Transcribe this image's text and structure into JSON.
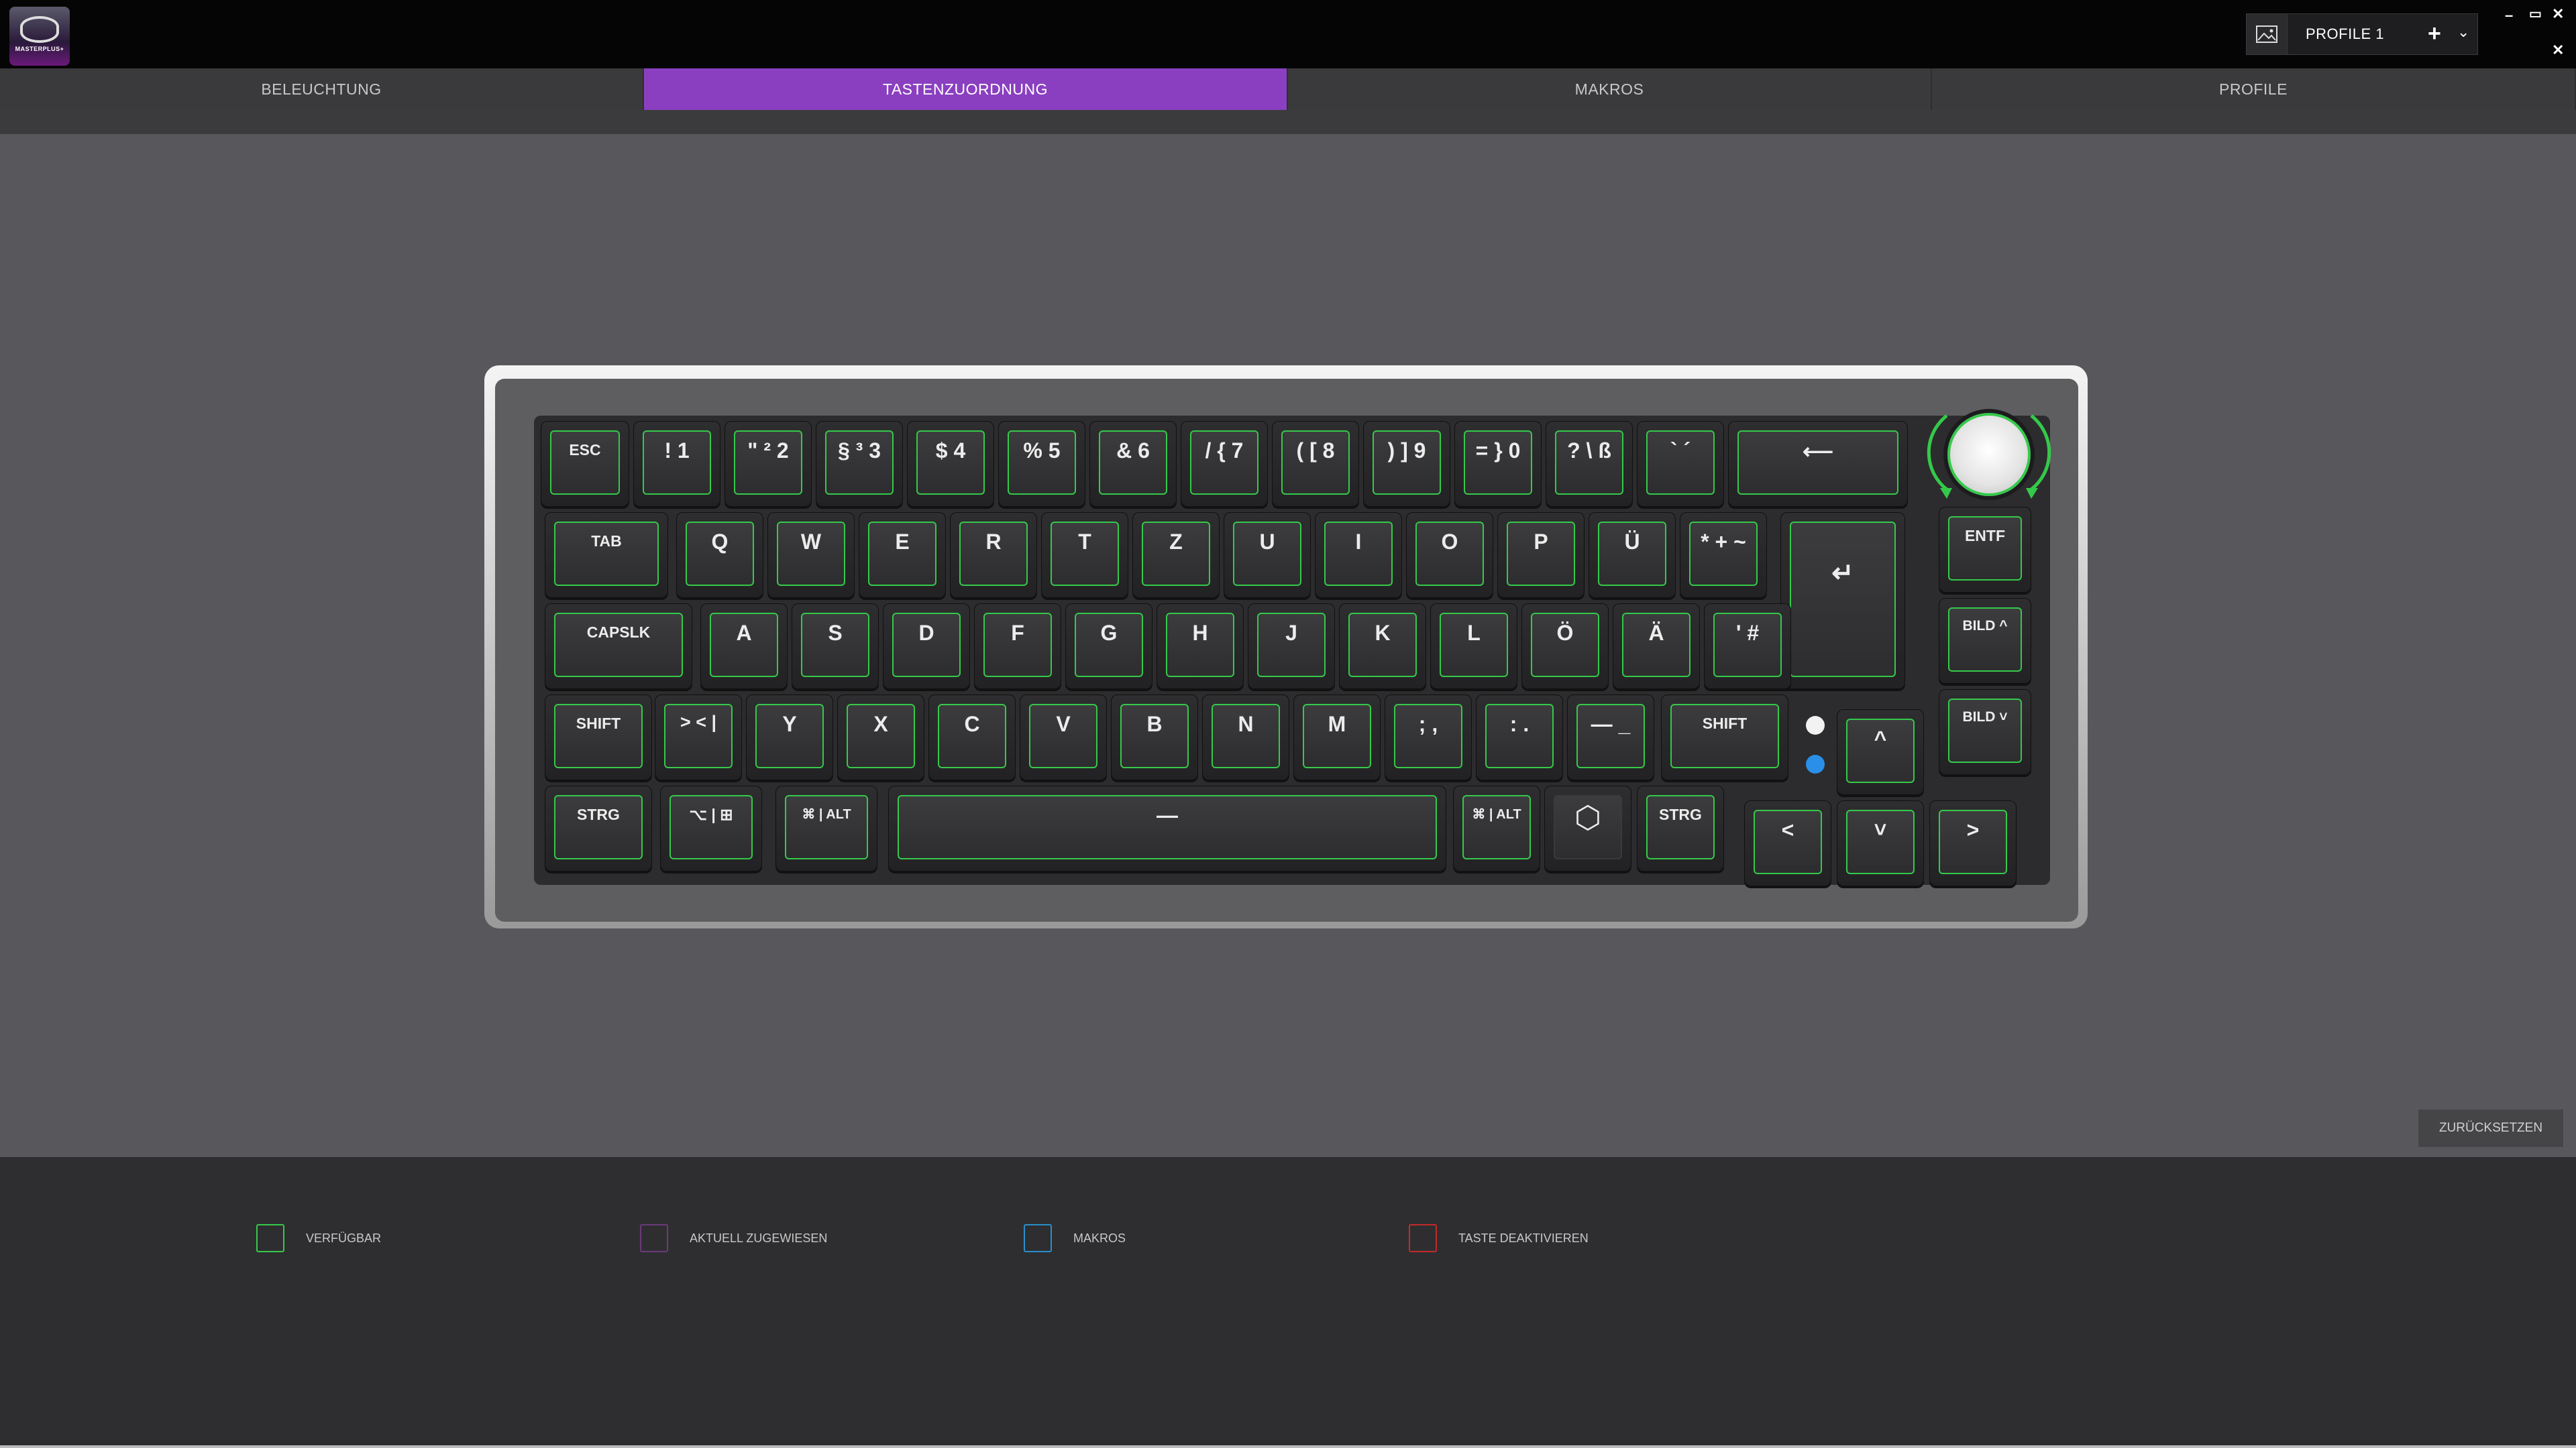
{
  "app": {
    "logo_text": "MASTERPLUS+"
  },
  "profile": {
    "name": "PROFILE 1",
    "add_icon": "+",
    "dropdown_icon": "⌄"
  },
  "window": {
    "minimize": "–",
    "maximize": "▭",
    "close": "✕",
    "close2": "✕"
  },
  "tabs": [
    {
      "label": "BELEUCHTUNG",
      "active": false
    },
    {
      "label": "TASTENZUORDNUNG",
      "active": true
    },
    {
      "label": "MAKROS",
      "active": false
    },
    {
      "label": "PROFILE",
      "active": false
    }
  ],
  "keys": {
    "r1": [
      "ESC",
      "! 1",
      "\" ² 2",
      "§ ³ 3",
      "$ 4",
      "% 5",
      "& 6",
      "/ { 7",
      "( [ 8",
      ") ] 9",
      "= } 0",
      "? \\ ß",
      "` ´",
      "⟵"
    ],
    "r2": [
      "TAB",
      "Q",
      "W",
      "E",
      "R",
      "T",
      "Z",
      "U",
      "I",
      "O",
      "P",
      "Ü",
      "* + ~",
      "↵"
    ],
    "r3": [
      "CAPSLK",
      "A",
      "S",
      "D",
      "F",
      "G",
      "H",
      "J",
      "K",
      "L",
      "Ö",
      "Ä",
      "' #"
    ],
    "r4": [
      "SHIFT",
      "> < |",
      "Y",
      "X",
      "C",
      "V",
      "B",
      "N",
      "M",
      "; ,",
      ": .",
      "— _",
      "SHIFT"
    ],
    "r5": [
      "STRG",
      "⌥ | ⊞",
      "⌘ | ALT",
      "—",
      "⌘ | ALT",
      "⬡",
      "STRG"
    ],
    "side": [
      "ENTF",
      "BILD ^",
      "BILD ˅"
    ],
    "arrows": [
      "^",
      "<",
      "˅",
      ">"
    ]
  },
  "reset_label": "ZURÜCKSETZEN",
  "legend": [
    {
      "label": "VERFÜGBAR",
      "color": "#35c94a"
    },
    {
      "label": "AKTUELL ZUGEWIESEN",
      "color": "#6b3a7a"
    },
    {
      "label": "MAKROS",
      "color": "#2a8fc9"
    },
    {
      "label": "TASTE DEAKTIVIEREN",
      "color": "#c42a2a"
    }
  ]
}
